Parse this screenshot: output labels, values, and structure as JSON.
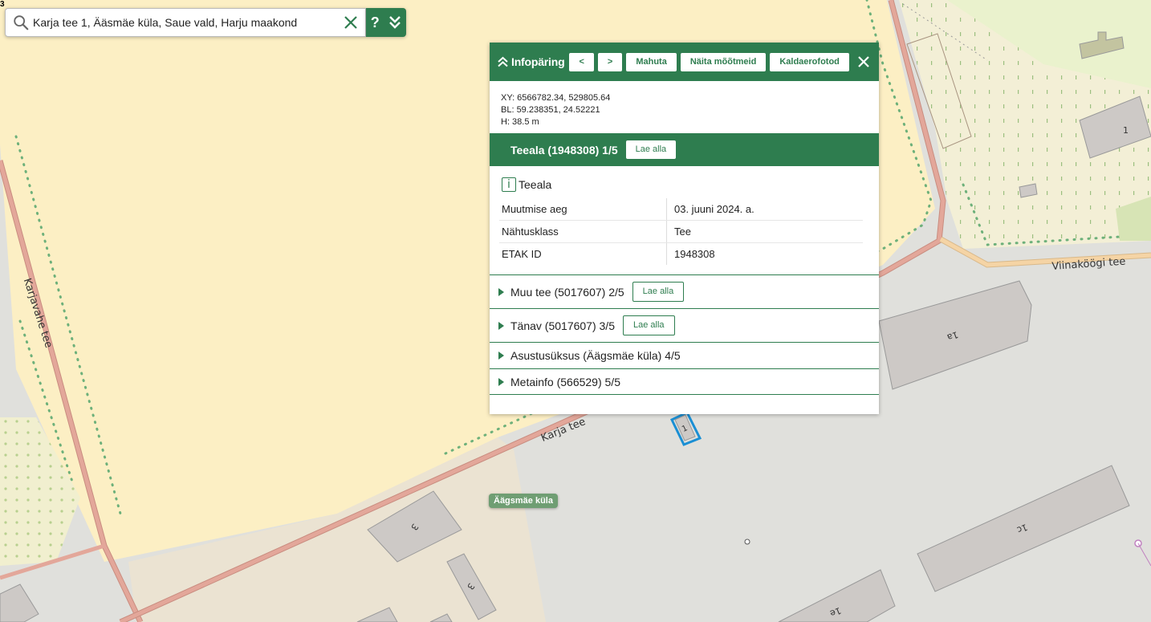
{
  "search": {
    "value": "Karja tee 1, Ääsmäe küla, Saue vald, Harju maakond",
    "help_label": "?",
    "icons": {
      "search": "search-icon",
      "clear": "close-icon",
      "expand": "double-chevron-down-icon"
    }
  },
  "panel": {
    "title": "Infopäring",
    "buttons": {
      "prev": "<",
      "next": ">",
      "fit": "Mahuta",
      "measurements": "Näita mõõtmeid",
      "oblique": "Kaldaerofotod"
    },
    "coords": {
      "xy": "XY: 6566782.34, 529805.64",
      "bl": "BL: 59.238351, 24.52221",
      "h": "H: 38.5 m"
    },
    "active": {
      "title": "Teeala (1948308) 1/5",
      "download": "Lae alla",
      "layer_name": "Teeala",
      "attributes": [
        {
          "key": "Muutmise aeg",
          "value": "03. juuni 2024. a."
        },
        {
          "key": "Nähtusklass",
          "value": "Tee"
        },
        {
          "key": "ETAK ID",
          "value": "1948308"
        }
      ]
    },
    "others": [
      {
        "title": "Muu tee (5017607) 2/5",
        "download": "Lae alla"
      },
      {
        "title": "Tänav (5017607) 3/5",
        "download": "Lae alla"
      },
      {
        "title": "Asustusüksus (Äägsmäe küla) 4/5"
      },
      {
        "title": "Metainfo (566529) 5/5"
      }
    ]
  },
  "map": {
    "roads": {
      "karjavahe": "Karjavahe tee",
      "karja": "Karja tee",
      "viinakoogi": "Viinaköögi tee"
    },
    "village": "Äägsmäe küla",
    "corner_number": "3",
    "buildings": [
      "1",
      "1a",
      "3",
      "3",
      "1c",
      "1e"
    ],
    "colors": {
      "field": "#fcefc4",
      "urban": "#e0e0dc",
      "road": "#e3a79a",
      "accent": "#2e7d4f"
    }
  }
}
